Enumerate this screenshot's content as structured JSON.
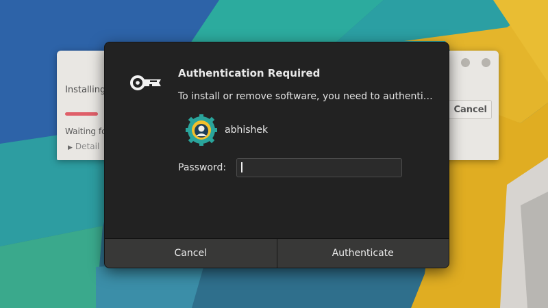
{
  "background_window": {
    "installing_text": "Installing",
    "waiting_text": "Waiting fo",
    "details_text": "Detail",
    "cancel_label": "Cancel"
  },
  "dialog": {
    "icon": "key-icon",
    "title": "Authentication Required",
    "message": "To install or remove software, you need to authenti…",
    "user": {
      "avatar_icon": "ubuntu-gear-avatar",
      "name": "abhishek"
    },
    "password_label": "Password:",
    "password_value": "",
    "buttons": {
      "cancel": "Cancel",
      "authenticate": "Authenticate"
    }
  },
  "colors": {
    "dialog_bg": "#222222",
    "button_bg": "#383837",
    "progress": "#df5f69",
    "avatar_teal": "#2aa59c",
    "avatar_yellow": "#f3c02c"
  }
}
